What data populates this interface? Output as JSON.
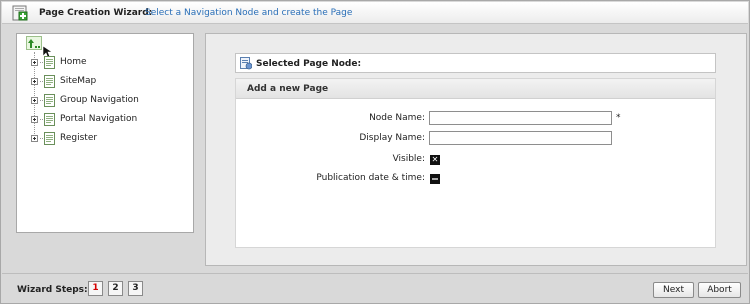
{
  "header": {
    "title": "Page Creation Wizard:",
    "subtitle": "Select a Navigation Node and create the Page",
    "icon": "add-page-icon"
  },
  "tree": {
    "up_icon": "level-up-icon",
    "items": [
      {
        "label": "Home"
      },
      {
        "label": "SiteMap"
      },
      {
        "label": "Group Navigation"
      },
      {
        "label": "Portal Navigation"
      },
      {
        "label": "Register"
      }
    ]
  },
  "selected": {
    "label": "Selected Page Node:",
    "value": ""
  },
  "form": {
    "title": "Add a new Page",
    "node_name_label": "Node Name:",
    "node_name_value": "",
    "required_mark": "*",
    "display_name_label": "Display Name:",
    "display_name_value": "",
    "visible_label": "Visible:",
    "visible_checked": true,
    "publication_label": "Publication date & time:",
    "publication_checked": false
  },
  "footer": {
    "steps_label": "Wizard Steps:",
    "steps": [
      "1",
      "2",
      "3"
    ],
    "active_step": "1",
    "next_label": "Next",
    "abort_label": "Abort"
  },
  "colors": {
    "link": "#2a6fb8",
    "active_step": "#d40000"
  }
}
